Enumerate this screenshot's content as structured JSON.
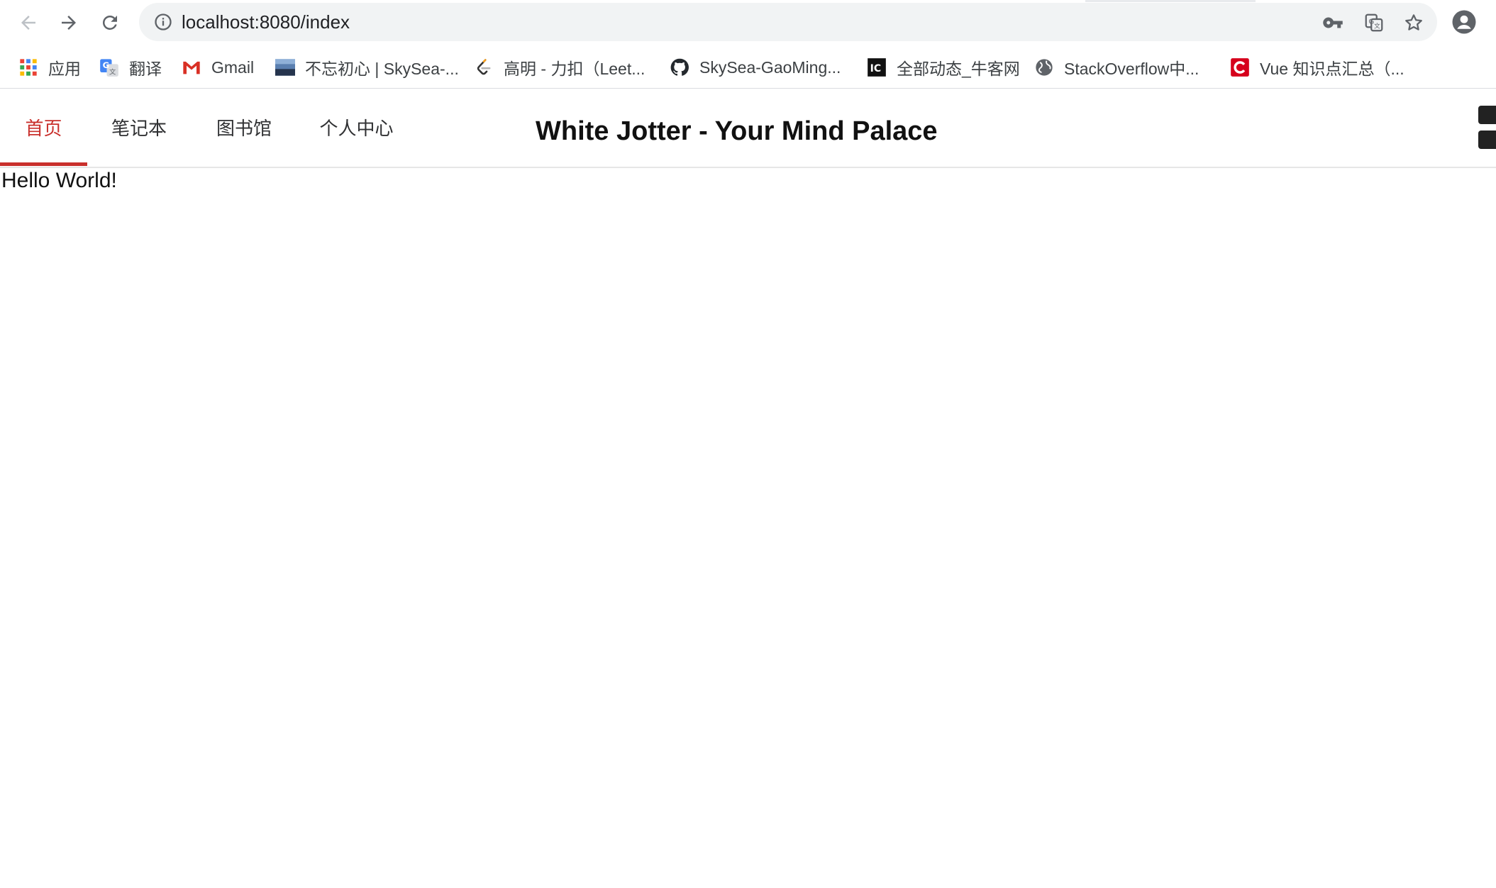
{
  "browser": {
    "url": "localhost:8080/index",
    "nav": {
      "back": "arrow-left-icon",
      "forward": "arrow-right-icon",
      "reload": "reload-icon"
    }
  },
  "bookmarks": [
    {
      "label": "应用",
      "icon": "apps-grid-icon"
    },
    {
      "label": "翻译",
      "icon": "google-translate-icon"
    },
    {
      "label": "Gmail",
      "icon": "gmail-icon"
    },
    {
      "label": "不忘初心 | SkySea-...",
      "icon": "landscape-thumbnail-icon"
    },
    {
      "label": "高明 - 力扣（Leet...",
      "icon": "leetcode-icon"
    },
    {
      "label": "SkySea-GaoMing...",
      "icon": "github-icon"
    },
    {
      "label": "全部动态_牛客网",
      "icon": "nowcoder-icon"
    },
    {
      "label": "StackOverflow中...",
      "icon": "globe-icon"
    },
    {
      "label": "Vue 知识点汇总（...",
      "icon": "csdn-icon"
    }
  ],
  "site": {
    "tabs": [
      {
        "label": "首页",
        "active": true
      },
      {
        "label": "笔记本",
        "active": false
      },
      {
        "label": "图书馆",
        "active": false
      },
      {
        "label": "个人中心",
        "active": false
      }
    ],
    "title": "White Jotter - Your Mind Palace"
  },
  "content": {
    "text": "Hello World!"
  },
  "colors": {
    "accent": "#c9302c",
    "omnibox": "#f1f3f4"
  }
}
